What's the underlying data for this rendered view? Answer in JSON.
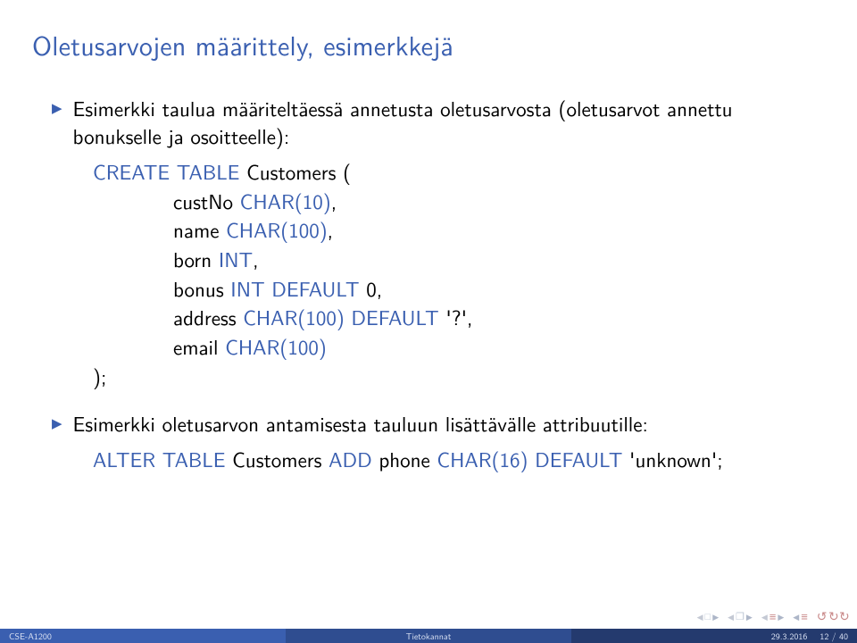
{
  "title": "Oletusarvojen määrittely, esimerkkejä",
  "bullet1": "Esimerkki taulua määriteltäessä annetusta oletusarvosta (oletusarvot annettu bonukselle ja osoitteelle):",
  "code": {
    "l1a": "CREATE TABLE",
    "l1b": " Customers (",
    "l2a": "custNo ",
    "l2b": "CHAR(10)",
    "l2c": ",",
    "l3a": "name ",
    "l3b": "CHAR(100)",
    "l3c": ",",
    "l4a": "born ",
    "l4b": "INT",
    "l4c": ",",
    "l5a": "bonus ",
    "l5b": "INT DEFAULT",
    "l5c": " 0,",
    "l6a": "address ",
    "l6b": "CHAR(100) DEFAULT",
    "l6c": " '?',",
    "l7a": "email ",
    "l7b": "CHAR(100)",
    "l8": ");"
  },
  "bullet2": "Esimerkki oletusarvon antamisesta tauluun lisättävälle attribuutille:",
  "alter": {
    "a": "ALTER TABLE",
    "b": " Customers ",
    "c": "ADD",
    "d": " phone ",
    "e": "CHAR(16) DEFAULT",
    "f": " 'unknown';"
  },
  "footer": {
    "left": "CSE-A1200",
    "mid": "Tietokannat",
    "date": "29.3.2016",
    "page": "12 / 40"
  }
}
